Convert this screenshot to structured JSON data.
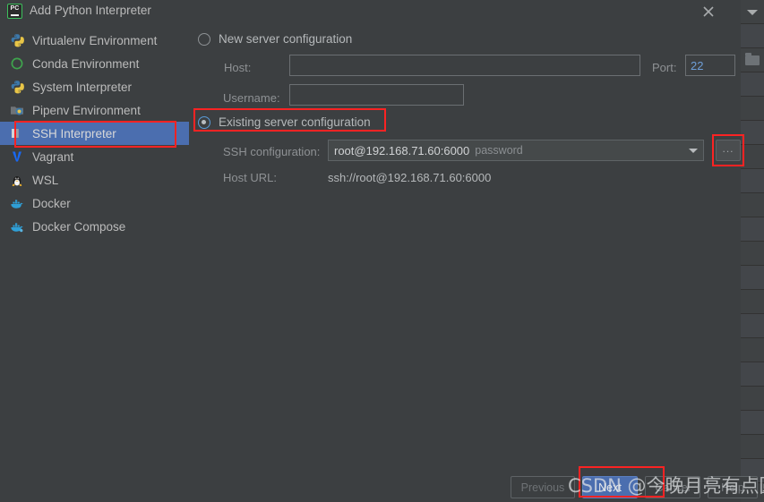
{
  "window": {
    "title": "Add Python Interpreter",
    "app_icon": "pycharm-icon",
    "close_icon": "close-icon",
    "accent_color": "#4b6eaf",
    "background_color": "#3c3f41",
    "annotation_color": "#fb2323"
  },
  "sidebar": {
    "items": [
      {
        "label": "Virtualenv Environment",
        "icon": "virtualenv-icon",
        "selected": false
      },
      {
        "label": "Conda Environment",
        "icon": "conda-icon",
        "selected": false
      },
      {
        "label": "System Interpreter",
        "icon": "python-icon",
        "selected": false
      },
      {
        "label": "Pipenv Environment",
        "icon": "pipenv-icon",
        "selected": false
      },
      {
        "label": "SSH Interpreter",
        "icon": "ssh-icon",
        "selected": true
      },
      {
        "label": "Vagrant",
        "icon": "vagrant-icon",
        "selected": false
      },
      {
        "label": "WSL",
        "icon": "wsl-icon",
        "selected": false
      },
      {
        "label": "Docker",
        "icon": "docker-icon",
        "selected": false
      },
      {
        "label": "Docker Compose",
        "icon": "docker-compose-icon",
        "selected": false
      }
    ]
  },
  "main": {
    "new_server": {
      "radio_label": "New server configuration",
      "selected": false,
      "host_label": "Host:",
      "host_value": "",
      "host_placeholder": "",
      "port_label": "Port:",
      "port_value": "22",
      "username_label": "Username:",
      "username_value": "",
      "username_placeholder": ""
    },
    "existing_server": {
      "radio_label": "Existing server configuration",
      "selected": true,
      "ssh_config_label": "SSH configuration:",
      "ssh_config_value": "root@192.168.71.60:6000",
      "ssh_config_auth": "password",
      "browse_label": "...",
      "dropdown_icon": "chevron-down-icon",
      "host_url_label": "Host URL:",
      "host_url_value": "ssh://root@192.168.71.60:6000"
    }
  },
  "footer": {
    "previous_label": "Previous",
    "next_label": "Next",
    "cancel_label": "Cancel",
    "help_label": "Help",
    "previous_enabled": false
  },
  "watermark": {
    "text": "CSDN @今晚月亮有点圆"
  }
}
